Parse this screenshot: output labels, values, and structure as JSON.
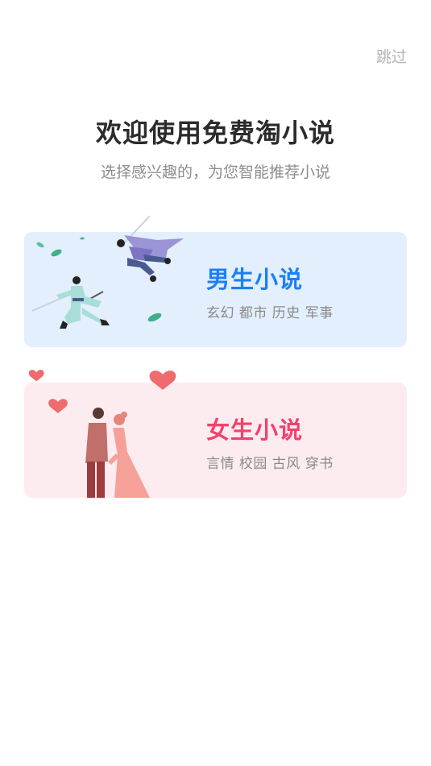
{
  "header": {
    "skip_label": "跳过"
  },
  "welcome": {
    "title": "欢迎使用免费淘小说",
    "subtitle": "选择感兴趣的，为您智能推荐小说"
  },
  "cards": [
    {
      "title": "男生小说",
      "tags": "玄幻 都市 历史 军事",
      "background": "#e3effd",
      "accent": "#1d7ff5",
      "illustration": "swordsmen-illustration"
    },
    {
      "title": "女生小说",
      "tags": "言情 校园 古风 穿书",
      "background": "#fdecef",
      "accent": "#f3406e",
      "illustration": "couple-hearts-illustration"
    }
  ]
}
